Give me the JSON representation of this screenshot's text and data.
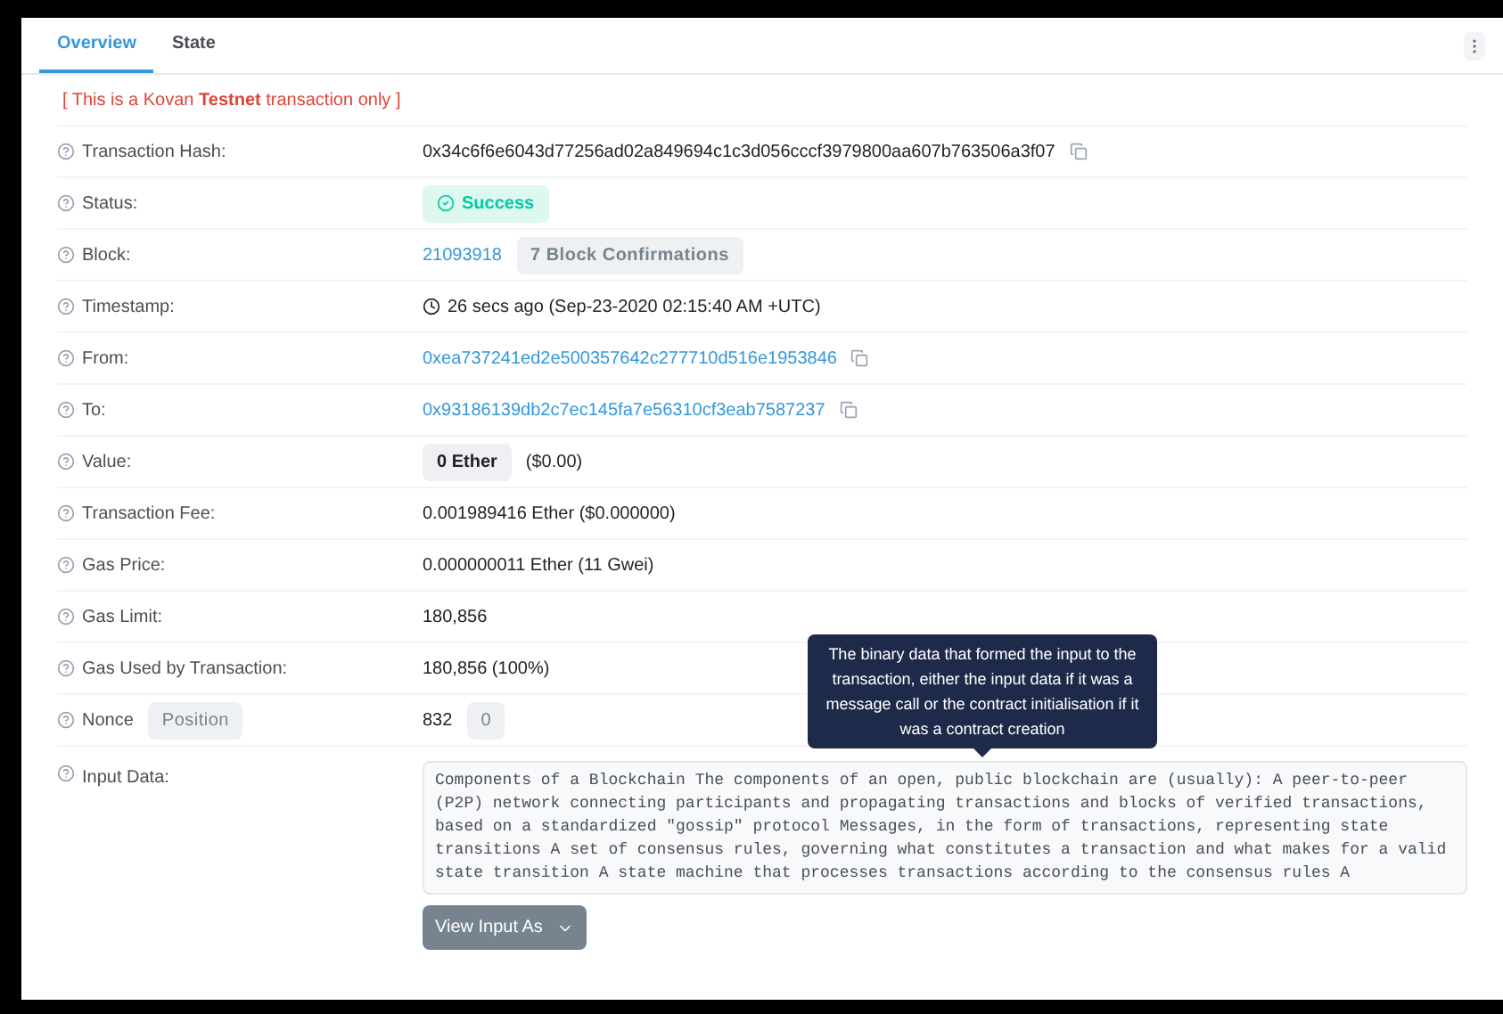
{
  "tabs": [
    {
      "label": "Overview",
      "selected": true
    },
    {
      "label": "State",
      "selected": false
    }
  ],
  "notice": "[ This is a Kovan **Testnet** transaction only ]",
  "rows": [
    {
      "kind": "hash",
      "label": "Transaction Hash:",
      "value": "0x34c6f6e6043d77256ad02a849694c1c3d056cccf3979800aa607b763506a3f07"
    },
    {
      "kind": "status",
      "label": "Status:",
      "value": "Success"
    },
    {
      "kind": "block",
      "label": "Block:",
      "value": "21093918",
      "badge": "7 Block Confirmations"
    },
    {
      "kind": "time",
      "label": "Timestamp:",
      "value": "26 secs ago (Sep-23-2020 02:15:40 AM +UTC)"
    },
    {
      "kind": "address",
      "label": "From:",
      "value": "0xea737241ed2e500357642c277710d516e1953846"
    },
    {
      "kind": "address",
      "label": "To:",
      "value": "0x93186139db2c7ec145fa7e56310cf3eab7587237"
    },
    {
      "kind": "amount",
      "label": "Value:",
      "badge": "0 Ether",
      "value": "($0.00)"
    },
    {
      "kind": "text",
      "label": "Transaction Fee:",
      "value": "0.001989416 Ether ($0.000000)"
    },
    {
      "kind": "text",
      "label": "Gas Price:",
      "value": "0.000000011 Ether (11 Gwei)"
    },
    {
      "kind": "text",
      "label": "Gas Limit:",
      "value": "180,856"
    },
    {
      "kind": "text",
      "label": "Gas Used by Transaction:",
      "value": "180,856 (100%)"
    },
    {
      "kind": "nonce",
      "label": "Nonce",
      "label_badge": "Position",
      "value": "832",
      "badge": "0"
    }
  ],
  "input_data": {
    "label": "Input Data:",
    "tooltip": "The binary data that formed the input to the transaction, either the input data if it was a message call or the contract initialisation if it was a contract creation",
    "value": "Components of a Blockchain The components of an open, public blockchain are (usually): A peer-to-peer (P2P) network connecting participants and propagating transactions and blocks of verified transactions, based on a standardized \"gossip\" protocol Messages, in the form of transactions, representing state transitions A set of consensus rules, governing what constitutes a transaction and what makes for a valid state transition A state machine that processes transactions according to the consensus rules A",
    "button": "View Input As"
  }
}
